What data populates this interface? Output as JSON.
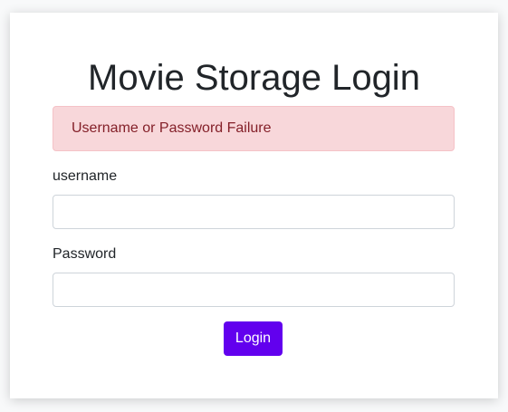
{
  "login": {
    "title": "Movie Storage Login",
    "error_message": "Username or Password Failure",
    "username_label": "username",
    "username_value": "",
    "password_label": "Password",
    "password_value": "",
    "login_button": "Login"
  },
  "colors": {
    "accent": "#6200ee",
    "alert_background": "#f8d7da",
    "alert_text": "#842029"
  }
}
